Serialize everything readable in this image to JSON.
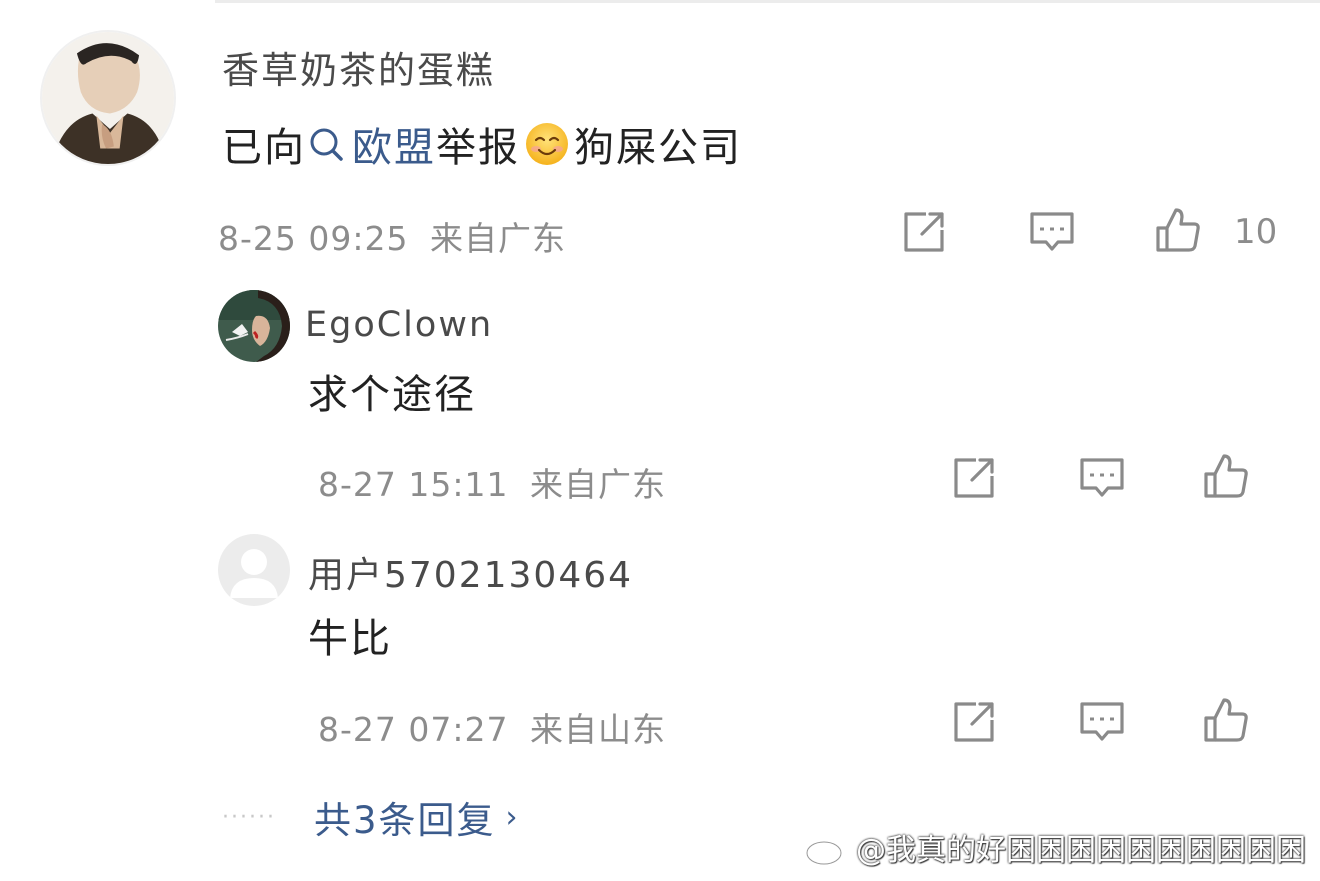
{
  "comment": {
    "username": "香草奶茶的蛋糕",
    "content": {
      "prefix": "已向",
      "topic": "欧盟",
      "middle": "举报",
      "emoji": "smiling-face-icon",
      "suffix": "狗屎公司"
    },
    "time": "8-25 09:25",
    "location": "来自广东",
    "like_count": "10"
  },
  "replies": [
    {
      "username": "EgoClown",
      "content": "求个途径",
      "time": "8-27 15:11",
      "location": "来自广东"
    },
    {
      "username": "用户5702130464",
      "content": "牛比",
      "time": "8-27 07:27",
      "location": "来自山东"
    }
  ],
  "reply_more": {
    "dots": "······",
    "label": "共3条回复",
    "arrow": "›"
  },
  "watermark": {
    "text": "@我真的好困困困困困困困困困困"
  },
  "icons": {
    "forward": "share-icon",
    "comment": "comment-icon",
    "like": "thumbs-up-icon",
    "search": "search-icon",
    "weibo": "weibo-logo-icon"
  },
  "colors": {
    "link": "#3b5b8c",
    "meta": "#8c8c8c",
    "icon": "#8a8a8a"
  }
}
